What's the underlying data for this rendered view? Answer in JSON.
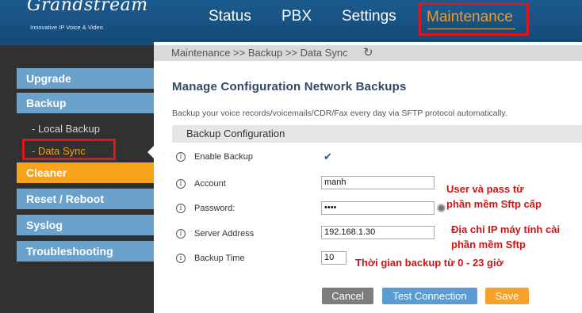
{
  "header": {
    "logo_text": "Grandstream",
    "logo_tagline": "Innovative IP Voice & Video",
    "nav": [
      "Status",
      "PBX",
      "Settings",
      "Maintenance"
    ],
    "active_nav": "Maintenance"
  },
  "sidebar": {
    "items": [
      "Upgrade",
      "Backup",
      "Cleaner",
      "Reset / Reboot",
      "Syslog",
      "Troubleshooting"
    ],
    "sub_items": [
      "-  Local Backup",
      "-  Data Sync"
    ],
    "active_sub": "Data Sync"
  },
  "breadcrumb": "Maintenance >> Backup >> Data Sync",
  "page": {
    "title": "Manage Configuration Network Backups",
    "description": "Backup your voice records/voicemails/CDR/Fax every day via SFTP protocol automatically.",
    "section": "Backup Configuration"
  },
  "form": {
    "enable_label": "Enable Backup",
    "enable_checked": true,
    "account_label": "Account",
    "account_value": "manh",
    "password_label": "Password:",
    "password_value": "••••",
    "server_label": "Server Address",
    "server_value": "192.168.1.30",
    "time_label": "Backup Time",
    "time_value": "10"
  },
  "annotations": {
    "user_pass": [
      "User và pass từ",
      "phần mềm Sftp cấp"
    ],
    "ip": [
      "Địa chỉ IP máy tính cài",
      "phần mềm Sftp"
    ],
    "time": "Thời gian backup từ 0 - 23 giờ"
  },
  "buttons": {
    "cancel": "Cancel",
    "test": "Test Connection",
    "save": "Save"
  },
  "colors": {
    "nav_bg": "#1c5b8e",
    "sidebar_bg": "#313131",
    "sidebar_item": "#6aa2cc",
    "accent_orange": "#f7a41a",
    "highlight_red": "#e0161f"
  },
  "icons": {
    "refresh": "refresh-icon",
    "info": "info-icon",
    "check": "check-icon",
    "password_eye": "password-toggle-icon"
  }
}
